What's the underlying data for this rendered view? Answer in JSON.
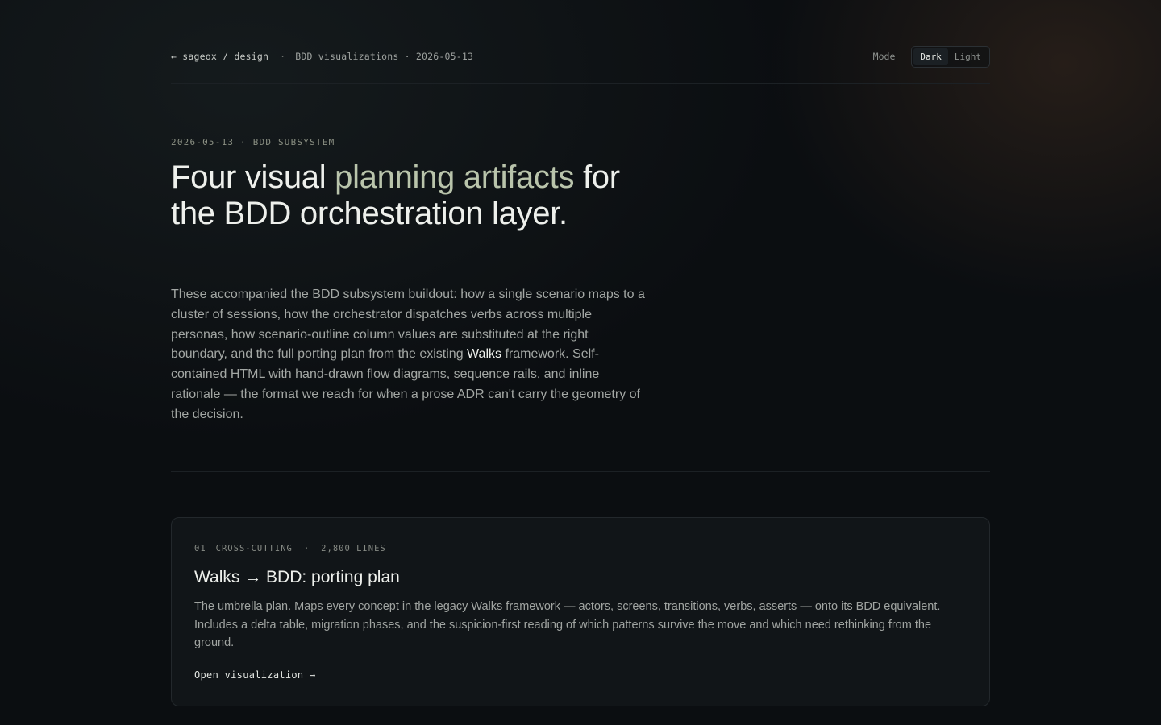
{
  "header": {
    "back_link": "← sageox / design",
    "separator": "·",
    "meta": "BDD visualizations · 2026-05-13",
    "mode_label": "Mode",
    "mode_options": [
      "Dark",
      "Light"
    ],
    "mode_selected": "Dark"
  },
  "hero": {
    "eyebrow": "2026-05-13 · BDD SUBSYSTEM",
    "title_part1": "Four visual ",
    "title_accent": "planning artifacts",
    "title_part2": " for the BDD orchestration layer.",
    "body_part1": "These accompanied the BDD subsystem buildout: how a single scenario maps to a cluster of sessions, how the orchestrator dispatches verbs across multiple personas, how scenario-outline column values are substituted at the right boundary, and the full porting plan from the existing ",
    "body_emphasis": "Walks",
    "body_part2": " framework. Self-contained HTML with hand-drawn flow diagrams, sequence rails, and inline rationale — the format we reach for when a prose ADR can't carry the geometry of the decision."
  },
  "cards": [
    {
      "number": "01",
      "category": "CROSS-CUTTING",
      "separator": "·",
      "lines": "2,800 LINES",
      "title": "Walks → BDD: porting plan",
      "description": "The umbrella plan. Maps every concept in the legacy Walks framework — actors, screens, transitions, verbs, asserts — onto its BDD equivalent. Includes a delta table, migration phases, and the suspicion-first reading of which patterns survive the move and which need rethinking from the ground.",
      "link_label": "Open visualization →"
    }
  ],
  "colors": {
    "background": "#0b0e11",
    "accent": "#b9c4ab",
    "card_background": "#111518",
    "border": "#23282c"
  }
}
